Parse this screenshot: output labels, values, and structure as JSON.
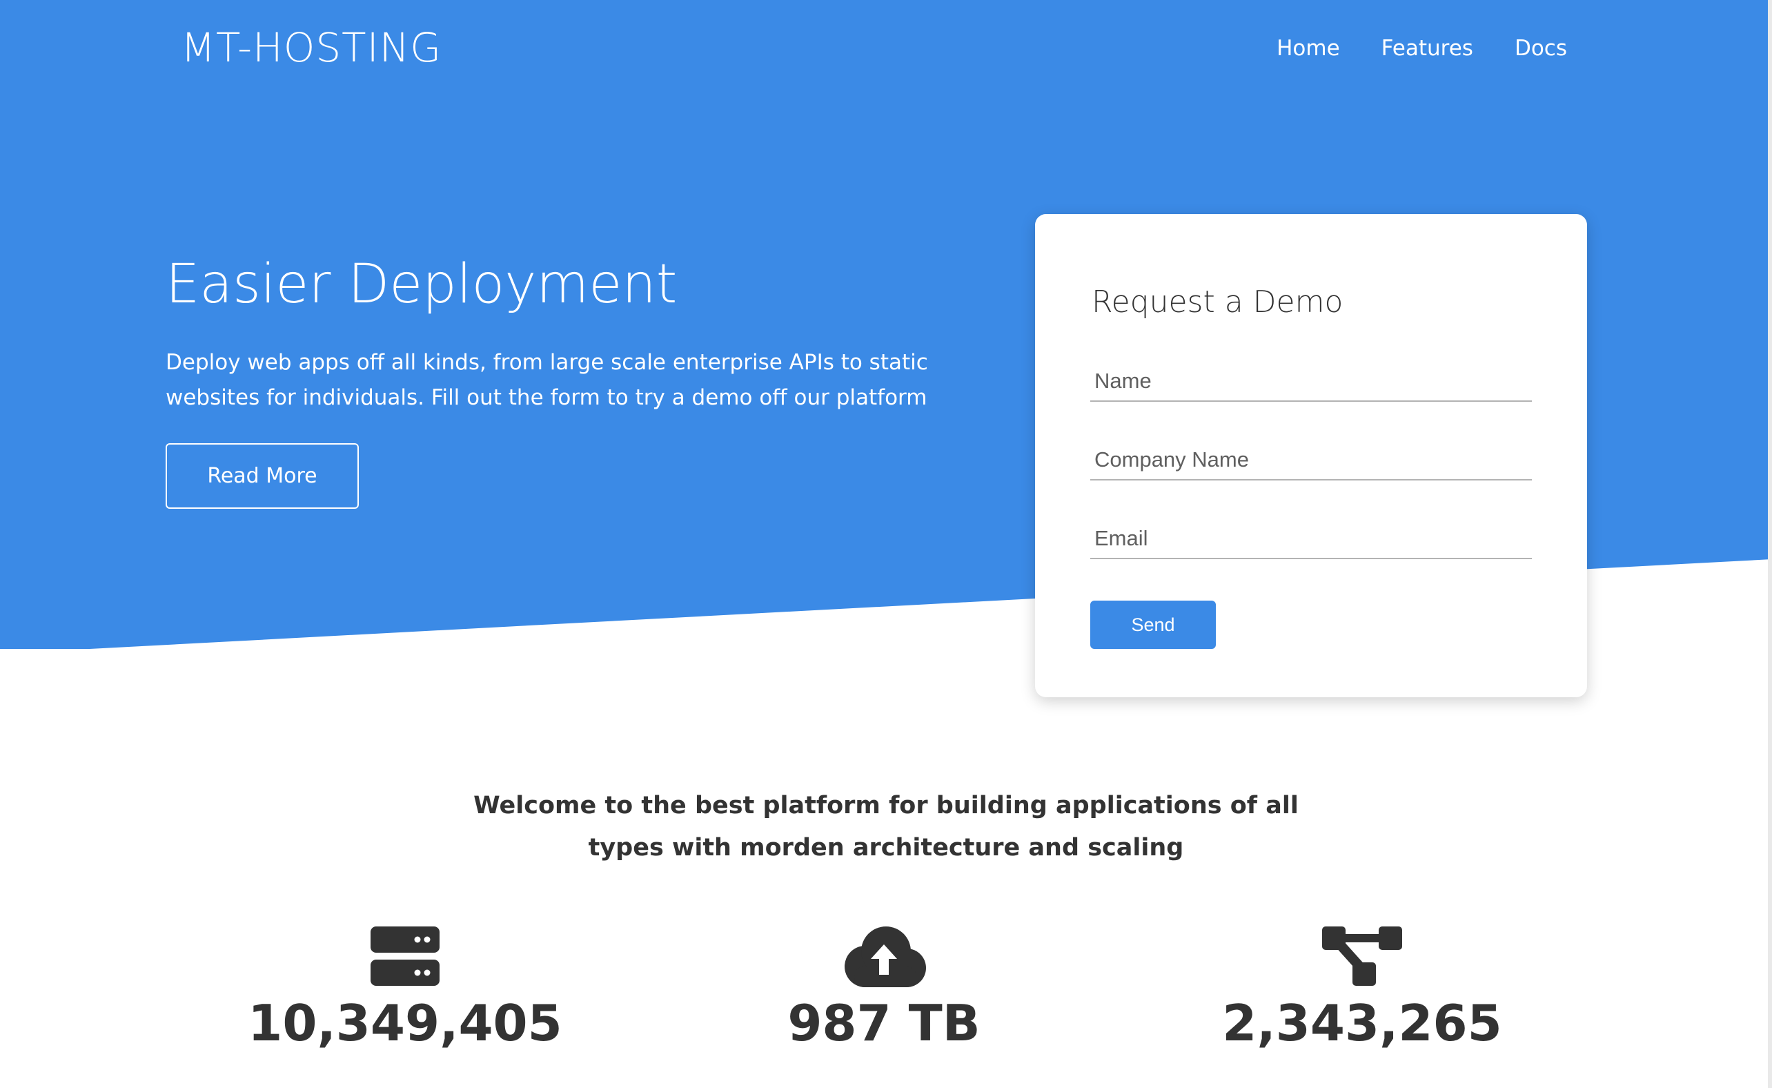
{
  "header": {
    "logo": "MT-HOSTING",
    "nav": [
      {
        "label": "Home"
      },
      {
        "label": "Features"
      },
      {
        "label": "Docs"
      }
    ]
  },
  "hero": {
    "title": "Easier Deployment",
    "text": "Deploy web apps off all kinds, from large scale enterprise APIs to static websites for individuals. Fill out the form to try a demo off our platform",
    "read_more_label": "Read More"
  },
  "demo_form": {
    "title": "Request a Demo",
    "fields": [
      {
        "placeholder": "Name",
        "value": ""
      },
      {
        "placeholder": "Company Name",
        "value": ""
      },
      {
        "placeholder": "Email",
        "value": ""
      }
    ],
    "send_label": "Send"
  },
  "welcome": {
    "text": "Welcome to the best platform for building applications of all types with morden architecture and scaling"
  },
  "stats": [
    {
      "icon": "server-icon",
      "value": "10,349,405"
    },
    {
      "icon": "cloud-upload-icon",
      "value": "987 TB"
    },
    {
      "icon": "sitemap-icon",
      "value": "2,343,265"
    }
  ],
  "colors": {
    "primary": "#3b8ae6",
    "text_dark": "#333333",
    "white": "#ffffff"
  }
}
